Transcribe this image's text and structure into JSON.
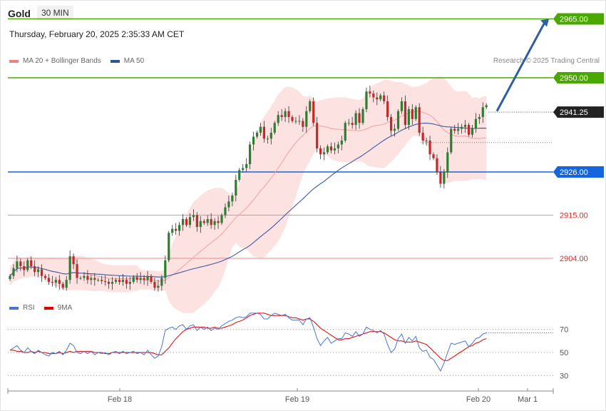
{
  "header": {
    "symbol": "Gold",
    "timeframe": "30 MIN",
    "datetime": "Thursday, February 20, 2025 2:35:33 AM CET",
    "credit": "Research © 2025 Trading Central"
  },
  "legend": {
    "main": [
      {
        "label": "MA 20 + Bollinger Bands",
        "color": "#f08080"
      },
      {
        "label": "MA 50",
        "color": "#2f5597"
      }
    ],
    "rsi": [
      {
        "label": "RSI",
        "color": "#4a74d8"
      },
      {
        "label": "9MA",
        "color": "#e00000"
      }
    ]
  },
  "colors": {
    "bull": "#2e7d32",
    "bear": "#c62828",
    "resistance": "#4aa800",
    "pivot": "#1565e0",
    "support": "#ef8a8a",
    "bands": "#fde2e2",
    "ma20": "#f4a0a0",
    "ma50": "#3c5aa0",
    "arrow": "#2f5fa0",
    "last_price": "#222222"
  },
  "chart_data": [
    {
      "type": "candlestick",
      "title": "Gold 30 MIN",
      "x_ticks": [
        "Feb 18",
        "Feb 19",
        "Feb 20",
        "Mar 1"
      ],
      "ylim": [
        2870,
        2970
      ],
      "levels": [
        {
          "value": 2965.0,
          "label": "2965.00",
          "kind": "resistance"
        },
        {
          "value": 2950.0,
          "label": "2950.00",
          "kind": "resistance"
        },
        {
          "value": 2926.0,
          "label": "2926.00",
          "kind": "pivot"
        },
        {
          "value": 2915.0,
          "label": "2915.00",
          "kind": "support"
        },
        {
          "value": 2904.0,
          "label": "2904.00",
          "kind": "support"
        }
      ],
      "last_price": {
        "value": 2941.25,
        "label": "2941.25"
      },
      "close": [
        2899.5,
        2901.5,
        2903.2,
        2902.0,
        2901.0,
        2903.5,
        2902.0,
        2900.5,
        2901.2,
        2899.5,
        2899.0,
        2898.0,
        2897.8,
        2898.5,
        2897.5,
        2896.5,
        2898.5,
        2904.5,
        2902.5,
        2899.0,
        2899.0,
        2899.5,
        2898.5,
        2899.0,
        2898.5,
        2898.5,
        2898.2,
        2898.0,
        2897.5,
        2898.0,
        2898.5,
        2898.0,
        2898.5,
        2897.5,
        2898.0,
        2899.2,
        2898.5,
        2899.0,
        2898.5,
        2899.5,
        2898.0,
        2896.5,
        2897.0,
        2899.0,
        2903.5,
        2910.5,
        2911.5,
        2911.0,
        2912.5,
        2914.0,
        2912.5,
        2914.5,
        2915.0,
        2912.0,
        2913.5,
        2913.0,
        2914.0,
        2912.5,
        2913.5,
        2913.0,
        2915.0,
        2917.0,
        2918.5,
        2920.0,
        2924.0,
        2926.5,
        2927.0,
        2928.0,
        2933.0,
        2935.0,
        2936.0,
        2937.5,
        2934.5,
        2934.5,
        2936.0,
        2938.5,
        2940.5,
        2940.0,
        2941.5,
        2940.0,
        2939.0,
        2939.0,
        2939.0,
        2937.5,
        2941.5,
        2944.0,
        2938.5,
        2932.0,
        2930.5,
        2931.0,
        2932.5,
        2931.5,
        2932.0,
        2933.0,
        2934.0,
        2938.5,
        2938.5,
        2938.0,
        2941.0,
        2938.5,
        2942.0,
        2946.5,
        2946.0,
        2945.0,
        2944.5,
        2945.5,
        2944.0,
        2940.0,
        2936.5,
        2937.0,
        2941.5,
        2944.0,
        2938.0,
        2942.0,
        2939.5,
        2942.5,
        2936.0,
        2934.0,
        2934.0,
        2930.5,
        2929.5,
        2926.0,
        2923.0,
        2926.0,
        2931.0,
        2937.0,
        2936.5,
        2937.0,
        2937.5,
        2938.0,
        2935.5,
        2937.0,
        2939.5,
        2940.0,
        2942.5,
        2943.0
      ],
      "rsi": {
        "levels": [
          30,
          50,
          70
        ],
        "ylim": [
          20,
          80
        ],
        "rsi": [
          52,
          54,
          56,
          52,
          50,
          54,
          51,
          49,
          52,
          50,
          48,
          47,
          50,
          49,
          51,
          48,
          52,
          58,
          56,
          50,
          49,
          51,
          49,
          51,
          48,
          50,
          49,
          50,
          48,
          50,
          51,
          49,
          51,
          49,
          50,
          51,
          49,
          50,
          48,
          52,
          48,
          45,
          47,
          55,
          69,
          71,
          72,
          70,
          73,
          74,
          70,
          73,
          74,
          69,
          72,
          70,
          72,
          69,
          71,
          70,
          73,
          75,
          77,
          78,
          80,
          81,
          80,
          81,
          84,
          84,
          84,
          83,
          79,
          79,
          82,
          84,
          83,
          82,
          83,
          80,
          78,
          78,
          78,
          74,
          79,
          80,
          72,
          62,
          56,
          60,
          63,
          58,
          60,
          62,
          62,
          67,
          66,
          64,
          68,
          64,
          66,
          72,
          70,
          69,
          67,
          69,
          66,
          57,
          50,
          53,
          62,
          66,
          58,
          63,
          60,
          64,
          54,
          51,
          52,
          46,
          44,
          39,
          34,
          41,
          50,
          58,
          57,
          58,
          59,
          60,
          55,
          58,
          62,
          63,
          66,
          67
        ],
        "ma9": [
          52,
          52,
          51,
          51,
          50,
          50,
          51,
          50,
          51,
          50,
          50,
          49,
          49,
          49,
          50,
          49,
          50,
          51,
          50,
          51,
          51,
          51,
          51,
          51,
          50,
          50,
          50,
          49,
          49,
          50,
          50,
          50,
          50,
          50,
          50,
          50,
          50,
          50,
          50,
          50,
          50,
          49,
          48,
          48,
          51,
          54,
          58,
          62,
          65,
          68,
          70,
          71,
          72,
          72,
          72,
          72,
          71,
          71,
          72,
          71,
          71,
          72,
          73,
          74,
          76,
          77,
          78,
          80,
          82,
          83,
          84,
          84,
          84,
          83,
          82,
          82,
          82,
          82,
          82,
          81,
          80,
          80,
          79,
          78,
          79,
          79,
          77,
          74,
          71,
          69,
          67,
          65,
          63,
          61,
          61,
          62,
          62,
          63,
          64,
          65,
          66,
          67,
          68,
          68,
          68,
          68,
          67,
          65,
          63,
          61,
          60,
          60,
          59,
          59,
          59,
          60,
          59,
          58,
          57,
          54,
          51,
          48,
          45,
          43,
          43,
          45,
          47,
          49,
          51,
          53,
          55,
          56,
          58,
          59,
          61,
          62
        ]
      }
    }
  ]
}
